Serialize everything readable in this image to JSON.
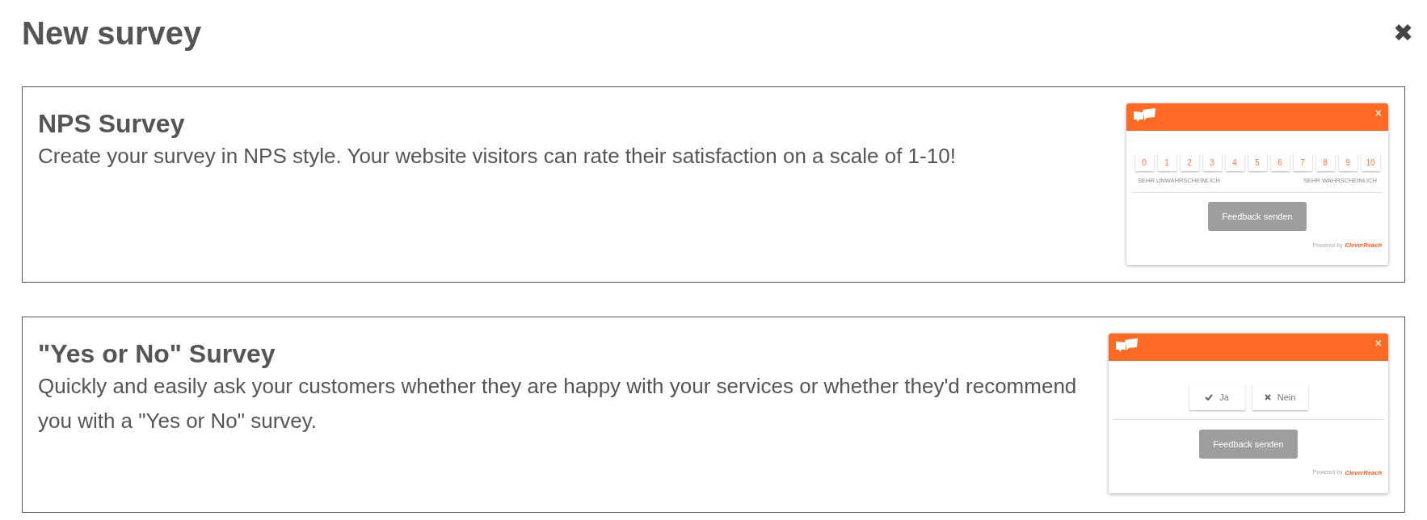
{
  "dialog": {
    "title": "New survey",
    "close": "✖"
  },
  "cards": [
    {
      "kind": "nps",
      "title": "NPS Survey",
      "description": "Create your survey in NPS style. Your website visitors can rate their satisfaction on a scale of 1-10!",
      "preview": {
        "close": "×",
        "scale": [
          "0",
          "1",
          "2",
          "3",
          "4",
          "5",
          "6",
          "7",
          "8",
          "9",
          "10"
        ],
        "low_label": "SEHR UNWAHRSCHEINLICH",
        "high_label": "SEHR WAHRSCHEINLICH",
        "submit": "Feedback senden",
        "powered_by": "Powered by",
        "brand": "CleverReach"
      }
    },
    {
      "kind": "yes_no",
      "title": "\"Yes or No\" Survey",
      "description": "Quickly and easily ask your customers whether they are happy with your services or whether they'd recommend you with a \"Yes or No\" survey.",
      "preview": {
        "close": "×",
        "yes": "Ja",
        "no": "Nein",
        "submit": "Feedback senden",
        "powered_by": "Powered by",
        "brand": "CleverReach"
      }
    }
  ]
}
